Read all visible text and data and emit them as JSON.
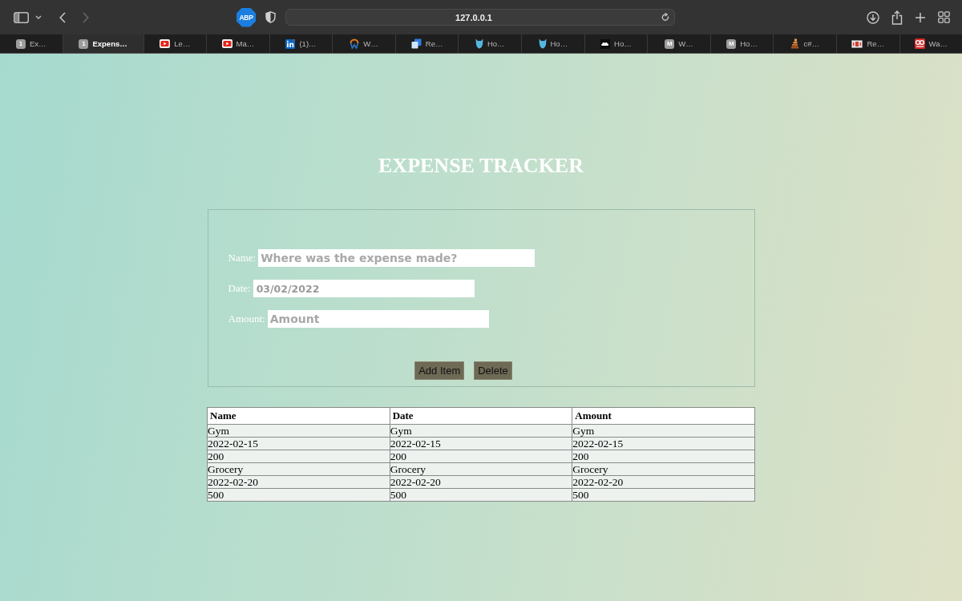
{
  "browser": {
    "back_disabled": false,
    "forward_disabled": true,
    "extension_badge": "ABP",
    "address": "127.0.0.1",
    "tabs": [
      {
        "kind": "letter",
        "badge": "1",
        "label": "Ex…",
        "selected": false
      },
      {
        "kind": "letter",
        "badge": "1",
        "label": "Expens…",
        "selected": true
      },
      {
        "kind": "play",
        "label": "Le…",
        "selected": false
      },
      {
        "kind": "play",
        "label": "Ma…",
        "selected": false
      },
      {
        "kind": "in-logo",
        "label": "(1)…",
        "selected": false
      },
      {
        "kind": "ring-logo",
        "label": "W…",
        "selected": false
      },
      {
        "kind": "squares",
        "label": "Re…",
        "selected": false
      },
      {
        "kind": "animal-head",
        "label": "Ho…",
        "selected": false
      },
      {
        "kind": "animal-head",
        "label": "Ho…",
        "selected": false
      },
      {
        "kind": "cloud",
        "label": "Ho…",
        "selected": false
      },
      {
        "kind": "letter",
        "badge": "M",
        "label": "W…",
        "selected": false
      },
      {
        "kind": "letter",
        "badge": "M",
        "label": "Ho…",
        "selected": false
      },
      {
        "kind": "stack",
        "label": "c#…",
        "selected": false
      },
      {
        "kind": "film",
        "label": "Re…",
        "selected": false
      },
      {
        "kind": "glasses",
        "label": "Wa…",
        "selected": false
      }
    ]
  },
  "page": {
    "title": "EXPENSE TRACKER",
    "form": {
      "fields": [
        {
          "kind": "text",
          "label": "Name:",
          "placeholder": "Where was the expense made?"
        },
        {
          "kind": "date",
          "label": "Date:",
          "value": "03/02/2022"
        },
        {
          "kind": "text",
          "label": "Amount:",
          "placeholder": "Amount"
        }
      ],
      "buttons": [
        "Add Item",
        "Delete"
      ]
    },
    "table": {
      "columns": [
        "Name",
        "Date",
        "Amount"
      ],
      "rows": [
        [
          "Gym",
          "Gym",
          "Gym"
        ],
        [
          "2022-02-15",
          "2022-02-15",
          "2022-02-15"
        ],
        [
          "200",
          "200",
          "200"
        ],
        [
          "Grocery",
          "Grocery",
          "Grocery"
        ],
        [
          "2022-02-20",
          "2022-02-20",
          "2022-02-20"
        ],
        [
          "500",
          "500",
          "500"
        ]
      ]
    }
  }
}
